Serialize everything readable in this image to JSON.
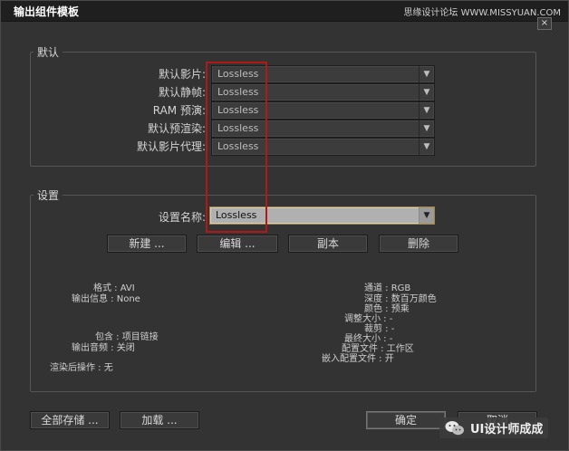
{
  "window": {
    "title": "输出组件模板",
    "watermark_top": "思缘设计论坛 WWW.MISSYUAN.COM",
    "close_glyph": "×"
  },
  "defaults_group": {
    "label": "默认",
    "rows": [
      {
        "label": "默认影片:",
        "value": "Lossless"
      },
      {
        "label": "默认静帧:",
        "value": "Lossless"
      },
      {
        "label": "RAM 预演:",
        "value": "Lossless"
      },
      {
        "label": "默认预渲染:",
        "value": "Lossless"
      },
      {
        "label": "默认影片代理:",
        "value": "Lossless"
      }
    ]
  },
  "settings_group": {
    "label": "设置",
    "name_label": "设置名称:",
    "name_value": "Lossless",
    "buttons": {
      "new": "新建 ...",
      "edit": "编辑 ...",
      "duplicate": "副本",
      "delete": "删除"
    },
    "info_left": [
      "格式 : AVI",
      "输出信息 : None",
      "包含 : 项目链接",
      "输出音频 : 关闭",
      "渲染后操作 : 无"
    ],
    "info_right": [
      "通道 : RGB",
      "深度 : 数百万颜色",
      "颜色 : 预乘",
      "调整大小 : -",
      "裁剪 : -",
      "最终大小 : -",
      "配置文件 : 工作区",
      "嵌入配置文件 : 开"
    ]
  },
  "footer": {
    "save_all": "全部存储 ...",
    "load": "加载 ...",
    "ok": "确定",
    "cancel": "取消"
  },
  "brand": {
    "text": "UI设计师成成",
    "icon": "wechat-icon"
  },
  "colors": {
    "highlight": "#b11818",
    "active_border": "#a5873a"
  }
}
